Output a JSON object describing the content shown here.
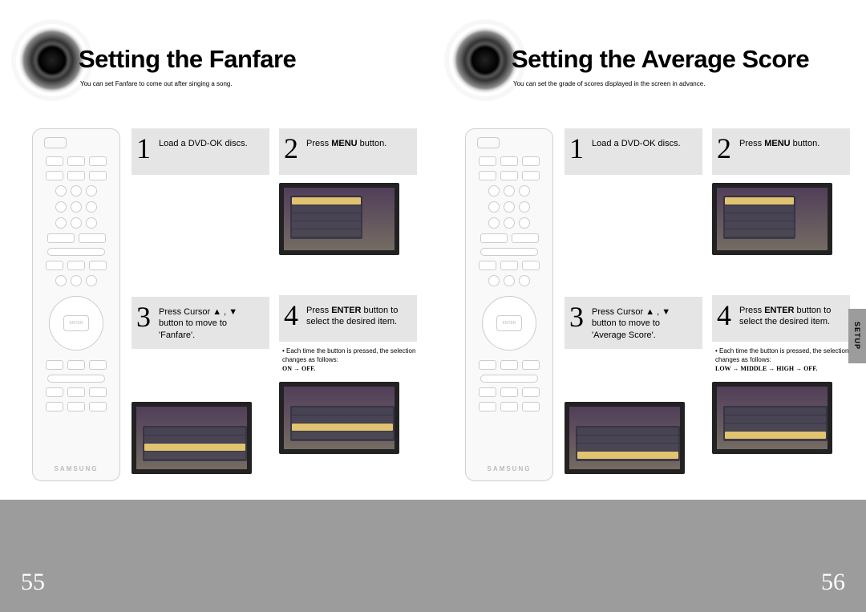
{
  "leftPage": {
    "title": "Setting the Fanfare",
    "subtitle": "You can set Fanfare to come out after singing a song.",
    "remoteBrand": "SAMSUNG",
    "steps": {
      "s1": {
        "num": "1",
        "text": "Load a DVD-OK discs."
      },
      "s2": {
        "num": "2",
        "prefix": "Press ",
        "bold": "MENU",
        "suffix": " button."
      },
      "s3": {
        "num": "3",
        "text": "Press Cursor ▲ , ▼ button to move to 'Fanfare'."
      },
      "s4": {
        "num": "4",
        "prefix": "Press ",
        "bold": "ENTER",
        "suffix": " button to select the desired item."
      }
    },
    "note": "• Each time the button is pressed, the selection changes as follows:",
    "noteSeq": "ON → OFF.",
    "pageNumber": "55"
  },
  "rightPage": {
    "title": "Setting the Average Score",
    "subtitle": "You can set the grade of scores displayed in the screen in advance.",
    "remoteBrand": "SAMSUNG",
    "steps": {
      "s1": {
        "num": "1",
        "text": "Load a DVD-OK discs."
      },
      "s2": {
        "num": "2",
        "prefix": "Press ",
        "bold": "MENU",
        "suffix": " button."
      },
      "s3": {
        "num": "3",
        "text": "Press Cursor ▲ , ▼ button to move to 'Average Score'."
      },
      "s4": {
        "num": "4",
        "prefix": "Press ",
        "bold": "ENTER",
        "suffix": " button to select the desired item."
      }
    },
    "note": "• Each time the button is pressed, the selection changes as follows:",
    "noteSeq": "LOW → MIDDLE → HIGH → OFF.",
    "sideTab": "SETUP",
    "pageNumber": "56"
  }
}
